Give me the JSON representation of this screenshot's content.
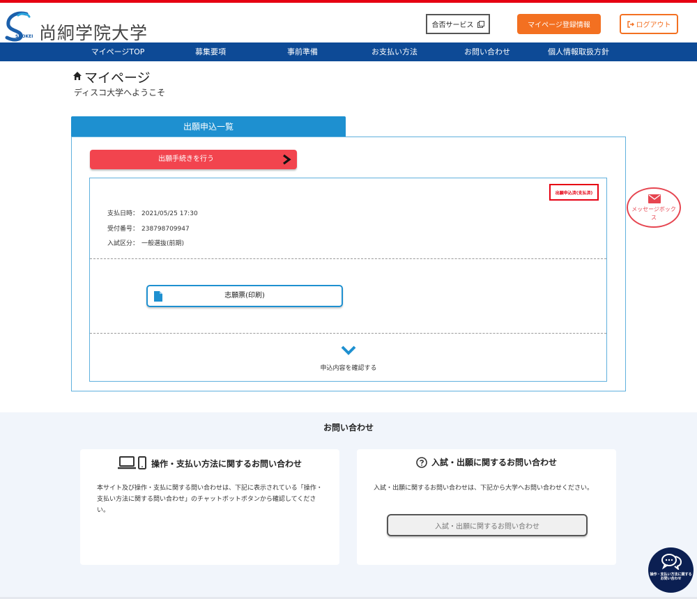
{
  "brand": {
    "name": "尚絅学院大学",
    "sub": "SHOKEI"
  },
  "header": {
    "pass_service_label": "合否サービス",
    "mypage_register_label": "マイページ登録情報",
    "logout_label": "ログアウト"
  },
  "nav": {
    "items": [
      {
        "label": "マイページTOP"
      },
      {
        "label": "募集要項"
      },
      {
        "label": "事前準備"
      },
      {
        "label": "お支払い方法"
      },
      {
        "label": "お問い合わせ"
      },
      {
        "label": "個人情報取扱方針"
      }
    ]
  },
  "page": {
    "title": "マイページ",
    "welcome": "ディスコ大学へようこそ"
  },
  "applications": {
    "tab_label": "出願申込一覧",
    "start_button_label": "出願手続きを行う",
    "status_badge": "出願申込済(支払済)",
    "payment_date_label": "支払日時：",
    "payment_date_value": "2021/05/25 17:30",
    "receipt_label": "受付番号：",
    "receipt_value": "238798709947",
    "exam_type_label": "入試区分：",
    "exam_type_value": "一般選抜(前期)",
    "print_button_label": "志願票(印刷)",
    "expand_label": "申込内容を確認する"
  },
  "message_box": {
    "label": "メッセージボックス"
  },
  "contact": {
    "title": "お問い合わせ",
    "card1_title": "操作・支払い方法に関するお問い合わせ",
    "card1_body": "本サイト及び操作・支払に関する問い合わせは、下記に表示されている「操作・支払い方法に関する問い合わせ」のチャットボットボタンから確認してください。",
    "card2_title": "入試・出願に関するお問い合わせ",
    "card2_body": "入試・出願に関するお問い合わせは、下記から大学へお問い合わせください。",
    "card2_button_label": "入試・出願に関するお問い合わせ"
  },
  "chatbot": {
    "label": "操作・支払い方法に関する お問い合わせ"
  },
  "colors": {
    "nav_bg": "#0d4a96",
    "accent_orange": "#f37021",
    "tab_blue": "#1e90d0",
    "apply_red": "#f2444e",
    "status_red": "#e60012"
  }
}
